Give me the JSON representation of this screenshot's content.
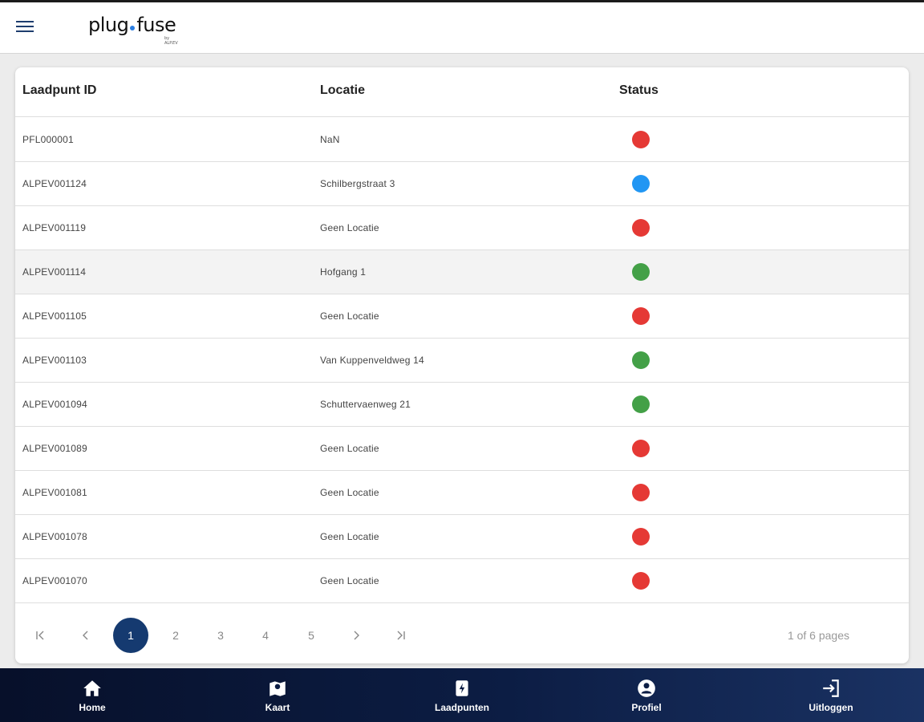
{
  "header": {
    "brand_word_left": "plug",
    "brand_word_right": "fuse",
    "brand_sub": "by ALP.EV"
  },
  "table": {
    "columns": [
      "Laadpunt ID",
      "Locatie",
      "Status"
    ],
    "rows": [
      {
        "id": "PFL000001",
        "location": "NaN",
        "status": "red"
      },
      {
        "id": "ALPEV001124",
        "location": "Schilbergstraat 3",
        "status": "blue"
      },
      {
        "id": "ALPEV001119",
        "location": "Geen Locatie",
        "status": "red"
      },
      {
        "id": "ALPEV001114",
        "location": "Hofgang 1",
        "status": "green"
      },
      {
        "id": "ALPEV001105",
        "location": "Geen Locatie",
        "status": "red"
      },
      {
        "id": "ALPEV001103",
        "location": "Van Kuppenveldweg 14",
        "status": "green"
      },
      {
        "id": "ALPEV001094",
        "location": "Schuttervaenweg 21",
        "status": "green"
      },
      {
        "id": "ALPEV001089",
        "location": "Geen Locatie",
        "status": "red"
      },
      {
        "id": "ALPEV001081",
        "location": "Geen Locatie",
        "status": "red"
      },
      {
        "id": "ALPEV001078",
        "location": "Geen Locatie",
        "status": "red"
      },
      {
        "id": "ALPEV001070",
        "location": "Geen Locatie",
        "status": "red"
      }
    ]
  },
  "status_colors": {
    "red": "#e53935",
    "blue": "#2196f3",
    "green": "#43a047"
  },
  "pagination": {
    "first_icon": "first-page-icon",
    "prev_icon": "chevron-left-icon",
    "pages": [
      "1",
      "2",
      "3",
      "4",
      "5"
    ],
    "active_page": "1",
    "next_icon": "chevron-right-icon",
    "last_icon": "last-page-icon",
    "info": "1 of 6 pages"
  },
  "bottom_nav": [
    {
      "label": "Home",
      "icon": "home-icon"
    },
    {
      "label": "Kaart",
      "icon": "map-icon"
    },
    {
      "label": "Laadpunten",
      "icon": "charger-icon"
    },
    {
      "label": "Profiel",
      "icon": "profile-icon"
    },
    {
      "label": "Uitloggen",
      "icon": "logout-icon"
    }
  ],
  "colors": {
    "accent": "#153a70",
    "nav_bg": "#0c1d44"
  }
}
